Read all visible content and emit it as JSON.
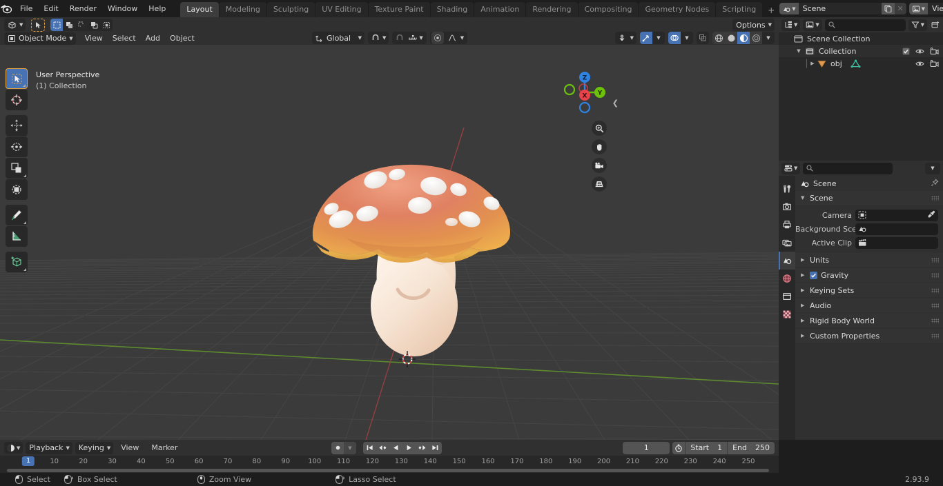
{
  "app": {
    "version": "2.93.9",
    "accent": "#4772b3",
    "highlight_orange": "#e8a33d",
    "viewport_bg": "#3b3b3b",
    "panel_bg": "#303030",
    "editor_bg": "#282828"
  },
  "topbar": {
    "logo_icon": "blender-logo-icon",
    "menus": [
      "File",
      "Edit",
      "Render",
      "Window",
      "Help"
    ],
    "workspace_tabs": [
      {
        "label": "Layout",
        "active": true
      },
      {
        "label": "Modeling",
        "active": false
      },
      {
        "label": "Sculpting",
        "active": false
      },
      {
        "label": "UV Editing",
        "active": false
      },
      {
        "label": "Texture Paint",
        "active": false
      },
      {
        "label": "Shading",
        "active": false
      },
      {
        "label": "Animation",
        "active": false
      },
      {
        "label": "Rendering",
        "active": false
      },
      {
        "label": "Compositing",
        "active": false
      },
      {
        "label": "Geometry Nodes",
        "active": false
      },
      {
        "label": "Scripting",
        "active": false
      }
    ],
    "add_workspace_label": "+",
    "scene": {
      "icon": "scene-icon",
      "name": "Scene",
      "copy_icon": "new-copy-icon",
      "unlink_icon": "x-icon"
    },
    "view_layer": {
      "icon": "view-layer-icon",
      "name": "View Layer",
      "copy_icon": "new-copy-icon",
      "unlink_icon": "x-icon"
    }
  },
  "viewport": {
    "header": {
      "editor_type_icon": "editor-type-3dview-icon",
      "cursor_tool_icon": "cursor-select-icon",
      "select_modes": [
        "select-set-icon",
        "select-extend-icon",
        "select-subtract-icon",
        "select-invert-icon",
        "select-intersect-icon"
      ],
      "mode": "Object Mode",
      "mode_icon": "object-mode-icon",
      "menus": [
        "View",
        "Select",
        "Add",
        "Object"
      ],
      "transform_orientation": "Global",
      "orientation_icon": "orientation-icon",
      "snap_icon": "magnet-icon",
      "snap_target_icon": "snap-increment-icon",
      "proportional_icon": "proportional-edit-icon",
      "falloff_icon": "smooth-falloff-icon",
      "options_label": "Options",
      "visibility_icon": "filter-visibility-icon",
      "gizmo_icon": "gizmo-icon",
      "overlays_icon": "overlays-icon",
      "xray_icon": "xray-icon",
      "shading_modes": [
        "wireframe-icon",
        "solid-icon",
        "material-preview-icon",
        "rendered-icon"
      ],
      "shading_active_index": 2
    },
    "toolbar": [
      {
        "name": "tweak-select-box-tool",
        "icon": "cursor-arrow-icon",
        "active": true
      },
      {
        "name": "cursor-tool",
        "icon": "crosshair-3d-cursor-icon",
        "active": false
      },
      {
        "name": "move-tool",
        "icon": "move-arrows-icon",
        "active": false
      },
      {
        "name": "rotate-tool",
        "icon": "rotate-icon",
        "active": false
      },
      {
        "name": "scale-tool",
        "icon": "scale-icon",
        "active": false
      },
      {
        "name": "transform-tool",
        "icon": "transform-icon",
        "active": false
      },
      {
        "name": "annotate-tool",
        "icon": "pencil-annotate-icon",
        "active": false
      },
      {
        "name": "measure-tool",
        "icon": "ruler-measure-icon",
        "active": false
      },
      {
        "name": "add-cube-tool",
        "icon": "add-cube-icon",
        "active": false
      }
    ],
    "overlay_text": {
      "line1": "User Perspective",
      "line2": "(1) Collection"
    },
    "gizmo_axes": [
      {
        "label": "Z",
        "color": "#2f83e3"
      },
      {
        "label": "Y",
        "color": "#6dc10b"
      },
      {
        "label": "X",
        "color": "#e8424a"
      }
    ],
    "nav_buttons": [
      "zoom-icon",
      "pan-hand-icon",
      "camera-view-icon",
      "toggle-perspective-icon"
    ],
    "sidebar_toggle_icon": "chevron-left-icon",
    "object": {
      "name": "mushroom-model",
      "cap_top_color": "#df7e5e",
      "cap_rim_color": "#e8a84a",
      "spot_color": "#f2f0ee",
      "stem_color": "#f4e3d3"
    },
    "grid": {
      "line_color": "#474747",
      "x_axis_color": "#9a3939",
      "y_axis_color": "#5a8a2b"
    }
  },
  "outliner": {
    "display_mode_icon": "outliner-display-mode-icon",
    "filter_id_icon": "filter-id-icon",
    "search_placeholder": "",
    "search_value": "",
    "filter_icon": "funnel-filter-icon",
    "new_collection_icon": "new-collection-icon",
    "rows": [
      {
        "label": "Scene Collection",
        "icon": "scene-collection-icon",
        "indent": 0,
        "disclosure": "",
        "controls": []
      },
      {
        "label": "Collection",
        "icon": "collection-icon",
        "indent": 1,
        "disclosure": "down",
        "controls": [
          "checkbox-icon",
          "eye-icon",
          "camera-icon"
        ]
      },
      {
        "label": "obj",
        "icon": "mesh-object-icon",
        "indent": 2,
        "disclosure": "right",
        "controls": [
          "eye-icon",
          "camera-icon"
        ],
        "data_icon": "mesh-data-icon"
      }
    ]
  },
  "properties": {
    "editor_icon": "properties-editor-icon",
    "search_placeholder": "",
    "search_value": "",
    "dropdown_icon": "chevron-down-icon",
    "tabs": [
      {
        "name": "tool-tab",
        "icon": "tool-wrench-screwdriver-icon",
        "active": false
      },
      {
        "name": "render-tab",
        "icon": "render-camera-back-icon",
        "active": false
      },
      {
        "name": "output-tab",
        "icon": "output-printer-icon",
        "active": false
      },
      {
        "name": "view-layer-tab",
        "icon": "view-layer-images-icon",
        "active": false
      },
      {
        "name": "scene-tab",
        "icon": "scene-cone-sphere-icon",
        "active": true
      },
      {
        "name": "world-tab",
        "icon": "world-globe-icon",
        "active": false
      },
      {
        "name": "collection-tab",
        "icon": "collection-box-icon",
        "active": false
      },
      {
        "name": "texture-tab",
        "icon": "texture-checker-icon",
        "active": false
      }
    ],
    "breadcrumb": {
      "icon": "scene-icon",
      "label": "Scene",
      "pin_icon": "pin-icon"
    },
    "panels": [
      {
        "label": "Scene",
        "expanded": true,
        "fields": [
          {
            "label": "Camera",
            "value": "",
            "icon": "camera-object-icon",
            "eyedropper": true
          },
          {
            "label": "Background Scene",
            "value": "",
            "icon": "scene-icon",
            "eyedropper": false
          },
          {
            "label": "Active Clip",
            "value": "",
            "icon": "movie-clip-icon",
            "eyedropper": false
          }
        ]
      },
      {
        "label": "Units",
        "expanded": false,
        "checkbox": null
      },
      {
        "label": "Gravity",
        "expanded": false,
        "checkbox": true
      },
      {
        "label": "Keying Sets",
        "expanded": false,
        "checkbox": null
      },
      {
        "label": "Audio",
        "expanded": false,
        "checkbox": null
      },
      {
        "label": "Rigid Body World",
        "expanded": false,
        "checkbox": null
      },
      {
        "label": "Custom Properties",
        "expanded": false,
        "checkbox": null
      }
    ]
  },
  "timeline": {
    "editor_icon": "timeline-editor-icon",
    "menus": [
      "Playback",
      "Keying",
      "View",
      "Marker"
    ],
    "auto_key_icon": "record-dot-icon",
    "transport": [
      "jump-to-start-icon",
      "jump-to-prev-keyframe-icon",
      "play-reverse-icon",
      "play-icon",
      "jump-to-next-keyframe-icon",
      "jump-to-end-icon"
    ],
    "current_frame": "1",
    "use_preview_range_icon": "stopwatch-icon",
    "start_label": "Start",
    "start_value": "1",
    "end_label": "End",
    "end_value": "250",
    "playhead_label": "1",
    "ruler_ticks": [
      10,
      20,
      30,
      40,
      50,
      60,
      70,
      80,
      90,
      100,
      110,
      120,
      130,
      140,
      150,
      160,
      170,
      180,
      190,
      200,
      210,
      220,
      230,
      240,
      250
    ]
  },
  "statusbar": {
    "items": [
      {
        "icon": "mouse-left-icon",
        "label": "Select"
      },
      {
        "icon": "mouse-left-drag-icon",
        "label": "Box Select"
      },
      {
        "icon": "mouse-middle-icon",
        "label": "Zoom View"
      },
      {
        "icon": "mouse-left-drag-icon",
        "label": "Lasso Select"
      }
    ],
    "version": "2.93.9"
  }
}
